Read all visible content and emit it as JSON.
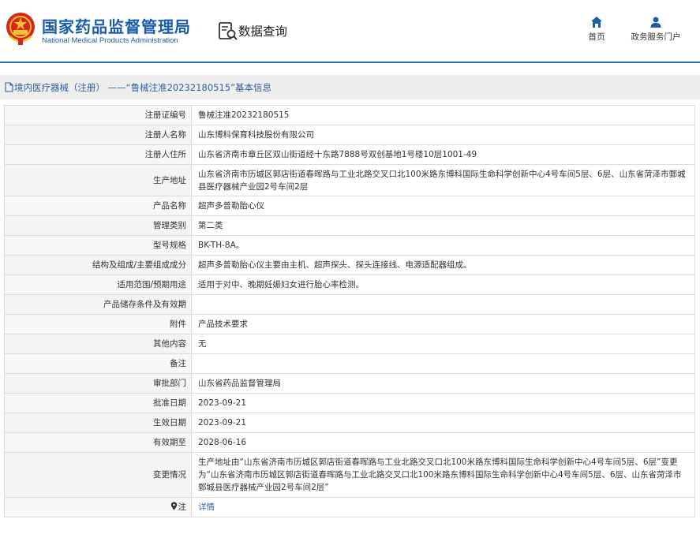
{
  "header": {
    "org_name_cn": "国家药品监督管理局",
    "org_name_en": "National Medical Products Administration",
    "section_title": "数据查询",
    "nav": [
      {
        "label": "首页",
        "icon": "home-icon"
      },
      {
        "label": "政务服务门户",
        "icon": "user-icon"
      }
    ]
  },
  "breadcrumb": {
    "text": "境内医疗器械（注册） ——“鲁械注准20232180515”基本信息"
  },
  "colors": {
    "brand_blue": "#1a5dab",
    "link_blue": "#2d6db5",
    "emblem_red": "#d8261d",
    "emblem_gold": "#f2c230"
  },
  "rows": [
    {
      "label": "注册证编号",
      "value": "鲁械注准20232180515"
    },
    {
      "label": "注册人名称",
      "value": "山东博科保育科技股份有限公司"
    },
    {
      "label": "注册人住所",
      "value": "山东省济南市章丘区双山街道经十东路7888号双创基地1号楼10层1001-49"
    },
    {
      "label": "生产地址",
      "value": "山东省济南市历城区郭店街道春晖路与工业北路交叉口北100米路东博科国际生命科学创新中心4号车间5层、6层、山东省菏泽市鄄城县医疗器械产业园2号车间2层"
    },
    {
      "label": "产品名称",
      "value": "超声多普勒胎心仪"
    },
    {
      "label": "管理类别",
      "value": "第二类"
    },
    {
      "label": "型号规格",
      "value": "BK-TH-8A。"
    },
    {
      "label": "结构及组成/主要组成成分",
      "value": "超声多普勒胎心仪主要由主机、超声探头、探头连接线、电源适配器组成。"
    },
    {
      "label": "适用范围/预期用途",
      "value": "适用于对中、晚期妊娠妇女进行胎心率检测。"
    },
    {
      "label": "产品储存条件及有效期",
      "value": ""
    },
    {
      "label": "附件",
      "value": "产品技术要求"
    },
    {
      "label": "其他内容",
      "value": "无"
    },
    {
      "label": "备注",
      "value": ""
    },
    {
      "label": "审批部门",
      "value": "山东省药品监督管理局"
    },
    {
      "label": "批准日期",
      "value": "2023-09-21"
    },
    {
      "label": "生效日期",
      "value": "2023-09-21"
    },
    {
      "label": "有效期至",
      "value": "2028-06-16"
    },
    {
      "label": "变更情况",
      "value": "生产地址由“山东省济南市历城区郭店街道春晖路与工业北路交叉口北100米路东博科国际生命科学创新中心4号车间5层、6层”变更为“山东省济南市历城区郭店街道春晖路与工业北路交叉口北100米路东博科国际生命科学创新中心4号车间5层、6层、山东省菏泽市鄄城县医疗器械产业园2号车间2层”"
    }
  ],
  "note_row": {
    "label": "注",
    "link": "详情",
    "icon": "location-pin-icon"
  }
}
